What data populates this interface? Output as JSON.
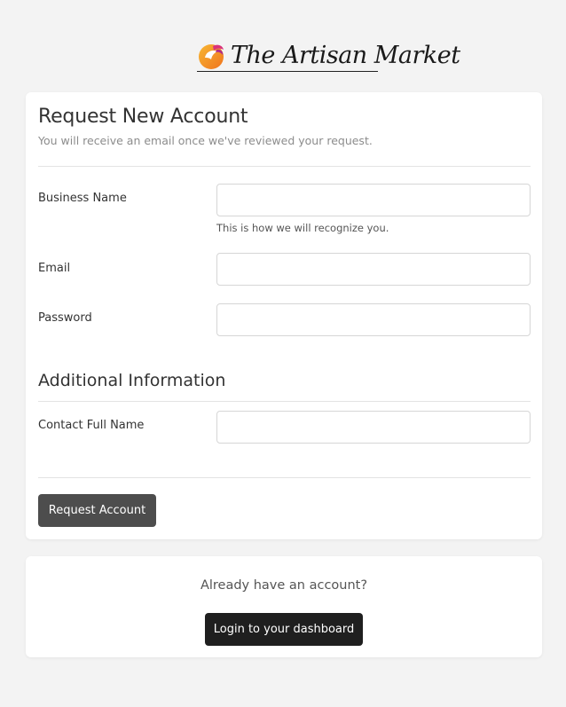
{
  "brand": {
    "name": "The Artisan Market",
    "logo_icon": "orange-circle-bird-icon"
  },
  "request_form": {
    "title": "Request New Account",
    "subtitle": "You will receive an email once we've reviewed your request.",
    "fields": {
      "business_name": {
        "label": "Business Name",
        "value": "",
        "placeholder": "",
        "help": "This is how we will recognize you."
      },
      "email": {
        "label": "Email",
        "value": "",
        "placeholder": ""
      },
      "password": {
        "label": "Password",
        "value": "",
        "placeholder": ""
      }
    },
    "additional": {
      "title": "Additional Information",
      "contact_full_name": {
        "label": "Contact Full Name",
        "value": "",
        "placeholder": ""
      }
    },
    "submit_label": "Request Account"
  },
  "login_card": {
    "prompt": "Already have an account?",
    "button_label": "Login to your dashboard"
  },
  "colors": {
    "background": "#f3f3f3",
    "card": "#ffffff",
    "primary_button": "#4d4d4d",
    "dark_button": "#1f1f1f",
    "logo_orange": "#f28a1e",
    "logo_pink": "#d9327a"
  }
}
